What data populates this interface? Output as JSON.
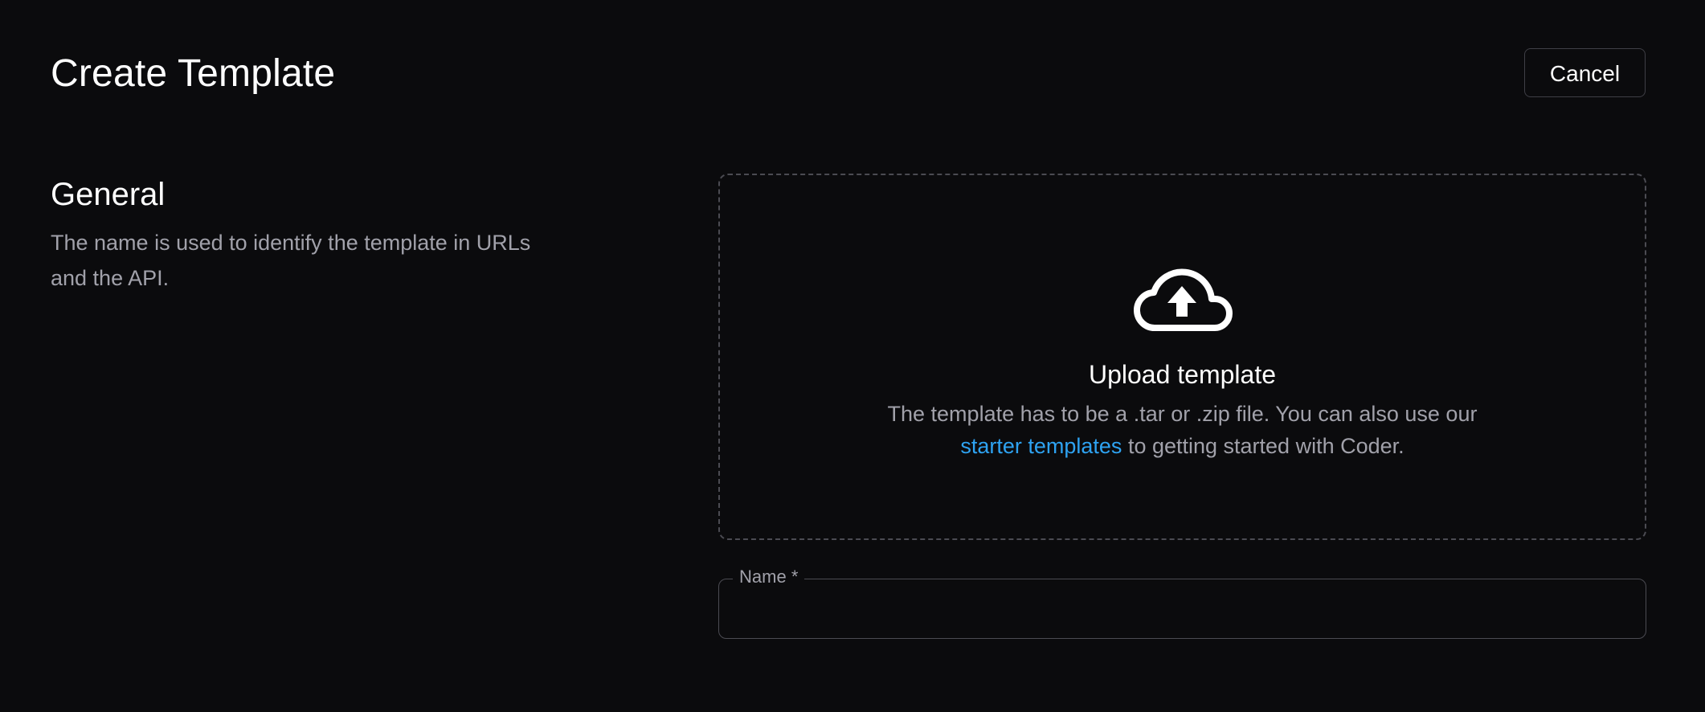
{
  "header": {
    "title": "Create Template",
    "cancel_label": "Cancel"
  },
  "general": {
    "title": "General",
    "description": "The name is used to identify the template in URLs and the API."
  },
  "upload": {
    "icon": "cloud-upload-icon",
    "title": "Upload template",
    "description_before": "The template has to be a .tar or .zip file. You can also use our ",
    "link_text": "starter templates",
    "description_after": " to getting started with Coder."
  },
  "name_field": {
    "label": "Name",
    "required_marker": "*",
    "value": ""
  },
  "colors": {
    "background": "#0b0b0d",
    "text_primary": "#ffffff",
    "text_secondary": "#a1a1aa",
    "link": "#2ea3f2",
    "border": "#4b4b52"
  }
}
